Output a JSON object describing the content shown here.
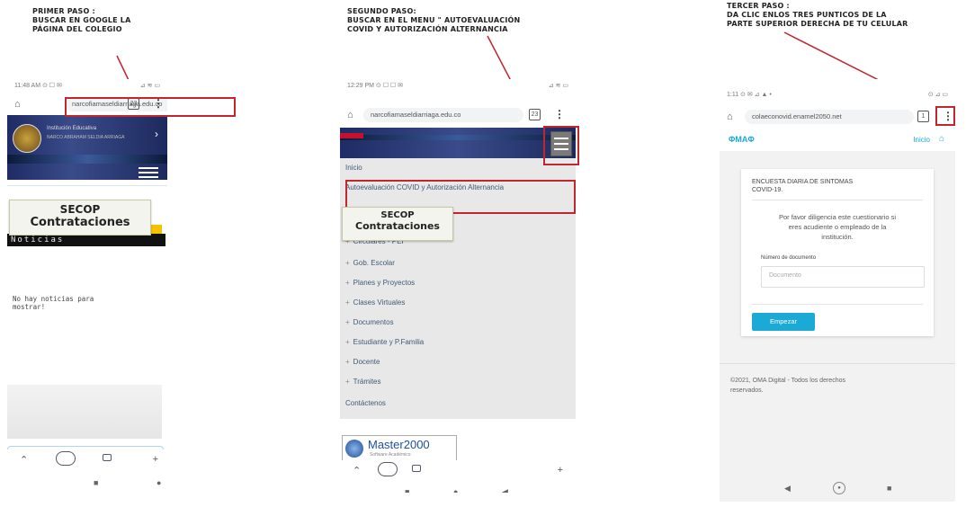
{
  "captions": {
    "step1": "PRIMER PASO :\nBUSCAR EN GOOGLE LA\nPÁGINA DEL COLEGIO",
    "step2": "SEGUNDO PASO:\nBUSCAR EN EL MENU \" AUTOEVALUACIÓN\nCOVID Y AUTORIZACIÓN ALTERNANCIA",
    "step3": "TERCER PASO :\nDA CLIC ENLOS TRES PUNTICOS DE LA\nPARTE SUPERIOR DERECHA DE TU CELULAR"
  },
  "phone1": {
    "status_time": "11:48 AM ⊙ ☐ ✉",
    "status_right": "⊿ ≋ ▭",
    "url": "narcofiamaseldiarriaga.edu.co",
    "tab_count": "23",
    "more": "⋮",
    "banner_title": "Institución Educativa",
    "banner_subtitle": "NARCO ABRAHAM SELDIA ARRIAGA",
    "secop_line1": "SECOP",
    "secop_line2": "Contrataciones",
    "news_header": "Noticias",
    "news_empty": "No hay noticias para\nmostrar!",
    "nav_back": "⌃",
    "nav_plus": "+"
  },
  "phone2": {
    "status_time": "12:29 PM ⊙ ☐ ☐ ✉",
    "status_right": "⊿ ≋ ▭",
    "url": "narcofiamaseldiarriaga.edu.co",
    "tab_count": "23",
    "more": "⋮",
    "menu": [
      "Inicio",
      "Autoevaluación COVID y Autorización Alternancia",
      "Circulares - PEI",
      "Gob. Escolar",
      "Planes y Proyectos",
      "Clases Virtuales",
      "Documentos",
      "Estudiante y P.Familia",
      "Docente",
      "Trámites",
      "Contáctenos"
    ],
    "secop_line1": "SECOP",
    "secop_line2": "Contrataciones",
    "master_label": "Master2000",
    "master_sub": "Software Académico",
    "nav_plus": "+"
  },
  "phone3": {
    "status_time": "1:11 ⊙ ✉ ⊿ ▲ •",
    "status_right": "⊙ ⊿ ▭",
    "url": "colaeconovid.enamel2050.net",
    "tab_count": "1",
    "more": "⋮",
    "brand": "ΦMAΦ",
    "inicio": "Inicio",
    "form_title": "ENCUESTA DIARIA DE SINTOMAS\nCOVID-19.",
    "form_instructions": "Por favor diligencia este cuestionario si\neres acudiente o empleado de la\ninstitución.",
    "doc_label": "Número de documento",
    "doc_placeholder": "Documento",
    "submit_label": "Empezar",
    "footer": "©2021, OMA Digital - Todos los derechos\nreservados."
  },
  "sysnav": {
    "back": "◀",
    "home": "●",
    "recent": "■"
  }
}
